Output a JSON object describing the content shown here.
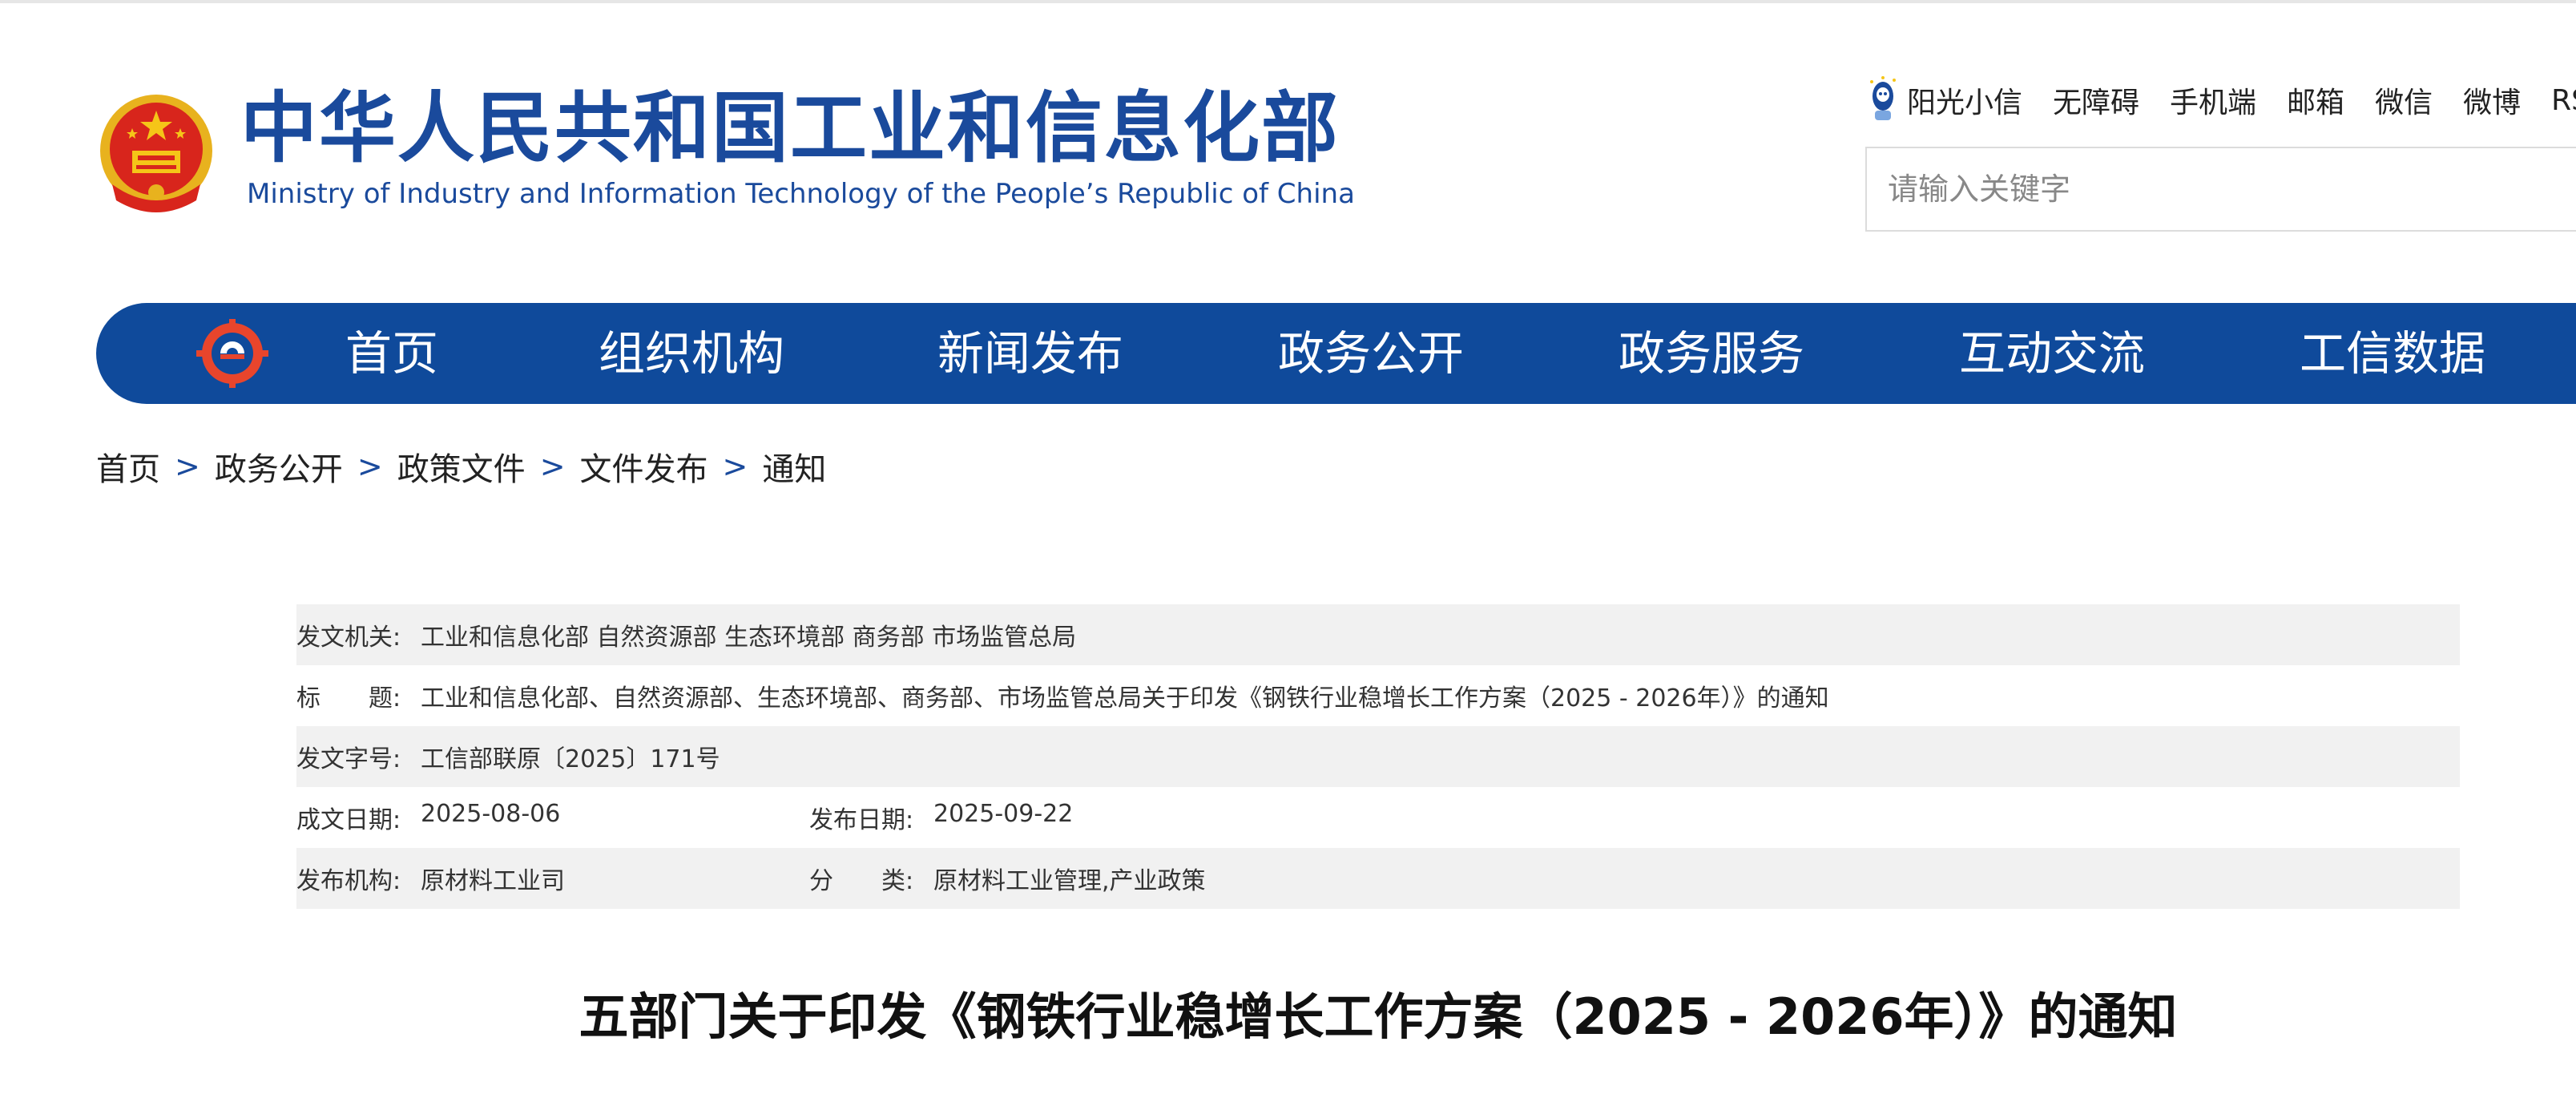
{
  "header": {
    "title": "中华人民共和国工业和信息化部",
    "subtitle": "Ministry of Industry and Information Technology of the People’s Republic of China"
  },
  "top_links": {
    "sunshine": "阳光小信",
    "accessibility": "无障碍",
    "mobile": "手机端",
    "mail": "邮箱",
    "wechat": "微信",
    "weibo": "微博",
    "rss": "RSS"
  },
  "search": {
    "placeholder": "请输入关键字",
    "value": ""
  },
  "nav": {
    "items": [
      {
        "label": "首页"
      },
      {
        "label": "组织机构"
      },
      {
        "label": "新闻发布"
      },
      {
        "label": "政务公开"
      },
      {
        "label": "政务服务"
      },
      {
        "label": "互动交流"
      },
      {
        "label": "工信数据"
      }
    ]
  },
  "breadcrumb": {
    "items": [
      "首页",
      "政务公开",
      "政策文件",
      "文件发布",
      "通知"
    ],
    "separator": ">"
  },
  "info": {
    "issuer_label": "发文机关:",
    "issuer_value": "工业和信息化部 自然资源部 生态环境部 商务部 市场监管总局",
    "title_label": "标　　题:",
    "title_value": "工业和信息化部、自然资源部、生态环境部、商务部、市场监管总局关于印发《钢铁行业稳增长工作方案（2025 - 2026年）》的通知",
    "doc_no_label": "发文字号:",
    "doc_no_value": "工信部联原〔2025〕171号",
    "written_date_label": "成文日期:",
    "written_date_value": "2025-08-06",
    "publish_date_label": "发布日期:",
    "publish_date_value": "2025-09-22",
    "publisher_label": "发布机构:",
    "publisher_value": "原材料工业司",
    "category_label": "分　　类:",
    "category_value": "原材料工业管理,产业政策"
  },
  "doc": {
    "title": "五部门关于印发《钢铁行业稳增长工作方案（2025 - 2026年）》的通知"
  },
  "colors": {
    "brand_blue": "#0f4a9b",
    "title_blue": "#1a4a9c",
    "shaded_row": "#f1f1f1"
  }
}
